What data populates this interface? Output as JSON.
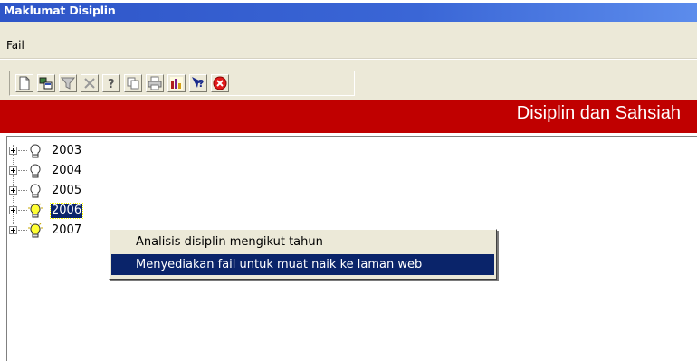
{
  "window": {
    "title": "Maklumat Disiplin"
  },
  "menu": {
    "items": [
      "Fail"
    ]
  },
  "toolbar": {
    "buttons": [
      {
        "icon": "new-document-icon"
      },
      {
        "icon": "tree-view-icon"
      },
      {
        "icon": "filter-icon"
      },
      {
        "icon": "delete-icon"
      },
      {
        "icon": "help-icon"
      },
      {
        "icon": "copy-icon"
      },
      {
        "icon": "print-icon"
      },
      {
        "icon": "report-chart-icon"
      },
      {
        "icon": "context-help-icon"
      },
      {
        "icon": "close-icon"
      }
    ]
  },
  "banner": {
    "title": "Disiplin dan Sahsiah",
    "color": "#c00000"
  },
  "tree": {
    "nodes": [
      {
        "label": "2003",
        "icon": "lightbulb-off-icon",
        "selected": false
      },
      {
        "label": "2004",
        "icon": "lightbulb-off-icon",
        "selected": false
      },
      {
        "label": "2005",
        "icon": "lightbulb-off-icon",
        "selected": false
      },
      {
        "label": "2006",
        "icon": "lightbulb-on-icon",
        "selected": true
      },
      {
        "label": "2007",
        "icon": "lightbulb-on-icon",
        "selected": false
      }
    ]
  },
  "context_menu": {
    "items": [
      {
        "label": "Analisis disiplin mengikut tahun",
        "highlighted": false
      },
      {
        "label": "Menyediakan fail untuk muat naik ke laman web",
        "highlighted": true
      }
    ]
  }
}
